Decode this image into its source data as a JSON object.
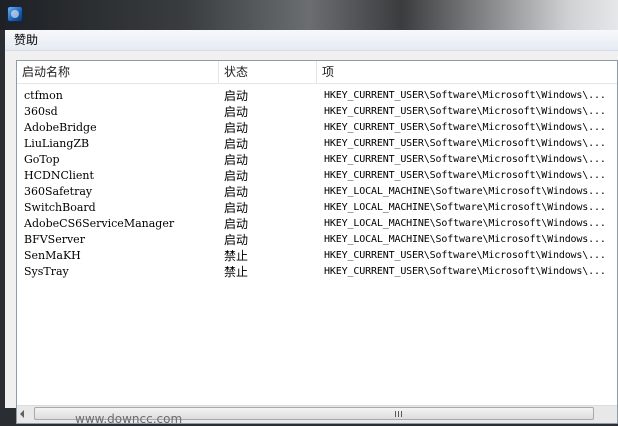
{
  "window": {
    "menu": [
      "赞助"
    ]
  },
  "list": {
    "columns": [
      "启动名称",
      "状态",
      "项"
    ],
    "rows": [
      {
        "name": "ctfmon",
        "status": "启动",
        "key": "HKEY_CURRENT_USER\\Software\\Microsoft\\Windows\\..."
      },
      {
        "name": "360sd",
        "status": "启动",
        "key": "HKEY_CURRENT_USER\\Software\\Microsoft\\Windows\\..."
      },
      {
        "name": "AdobeBridge",
        "status": "启动",
        "key": "HKEY_CURRENT_USER\\Software\\Microsoft\\Windows\\..."
      },
      {
        "name": "LiuLiangZB",
        "status": "启动",
        "key": "HKEY_CURRENT_USER\\Software\\Microsoft\\Windows\\..."
      },
      {
        "name": "GoTop",
        "status": "启动",
        "key": "HKEY_CURRENT_USER\\Software\\Microsoft\\Windows\\..."
      },
      {
        "name": "HCDNClient",
        "status": "启动",
        "key": "HKEY_CURRENT_USER\\Software\\Microsoft\\Windows\\..."
      },
      {
        "name": "360Safetray",
        "status": "启动",
        "key": "HKEY_LOCAL_MACHINE\\Software\\Microsoft\\Windows..."
      },
      {
        "name": "SwitchBoard",
        "status": "启动",
        "key": "HKEY_LOCAL_MACHINE\\Software\\Microsoft\\Windows..."
      },
      {
        "name": "AdobeCS6ServiceManager",
        "status": "启动",
        "key": "HKEY_LOCAL_MACHINE\\Software\\Microsoft\\Windows..."
      },
      {
        "name": "BFVServer",
        "status": "启动",
        "key": "HKEY_LOCAL_MACHINE\\Software\\Microsoft\\Windows..."
      },
      {
        "name": "SenMaKH",
        "status": "禁止",
        "key": "HKEY_CURRENT_USER\\Software\\Microsoft\\Windows\\..."
      },
      {
        "name": "SysTray",
        "status": "禁止",
        "key": "HKEY_CURRENT_USER\\Software\\Microsoft\\Windows\\..."
      }
    ]
  },
  "scrollbar": {
    "grip_label": "III"
  },
  "watermark": "www.downcc.com"
}
